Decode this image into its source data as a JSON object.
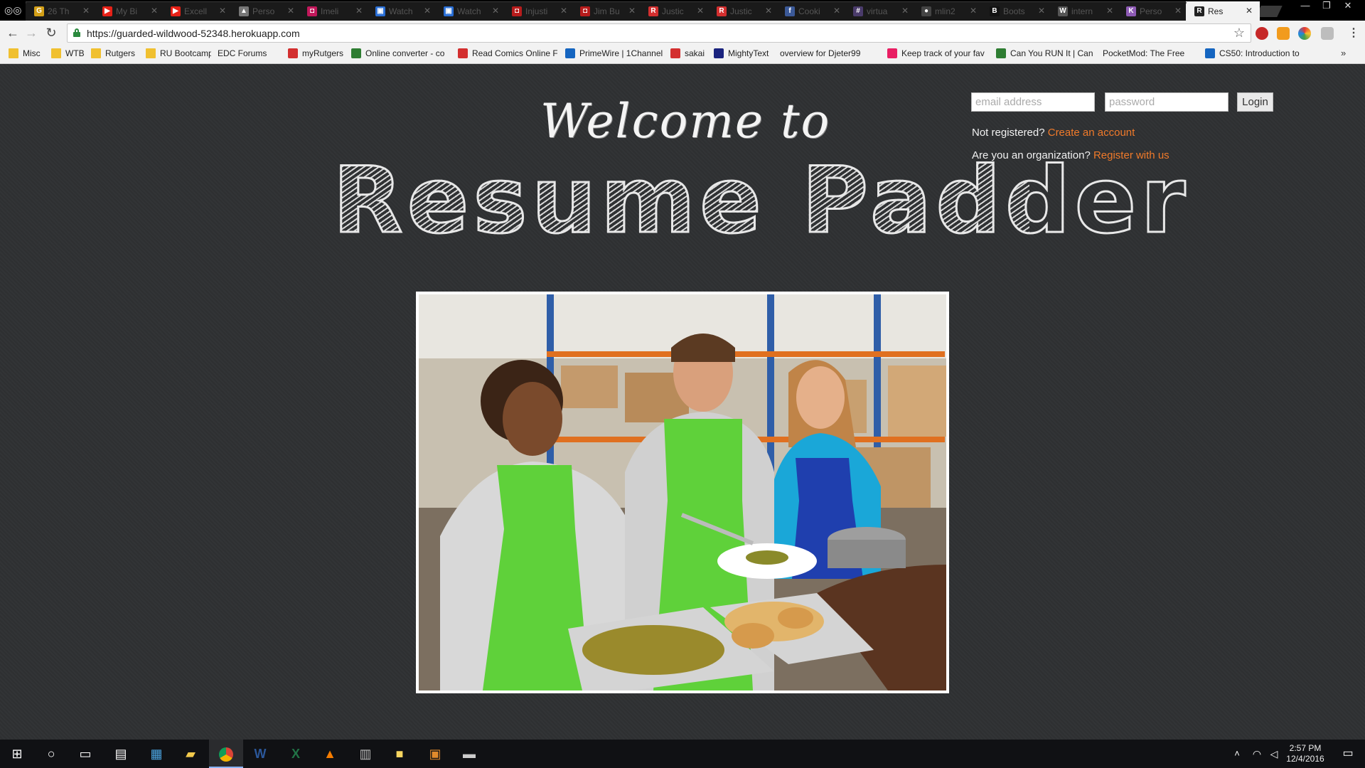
{
  "browser": {
    "tabs": [
      {
        "title": "26 Th",
        "favicon_color": "#d4a017",
        "favicon_glyph": "G"
      },
      {
        "title": "My Bi",
        "favicon_color": "#e62117",
        "favicon_glyph": "▶"
      },
      {
        "title": "Excell",
        "favicon_color": "#e62117",
        "favicon_glyph": "▶"
      },
      {
        "title": "Perso",
        "favicon_color": "#777777",
        "favicon_glyph": "▲"
      },
      {
        "title": "Imeli",
        "favicon_color": "#c2185b",
        "favicon_glyph": "◘"
      },
      {
        "title": "Watch",
        "favicon_color": "#2a6fd6",
        "favicon_glyph": "▣"
      },
      {
        "title": "Watch",
        "favicon_color": "#2a6fd6",
        "favicon_glyph": "▣"
      },
      {
        "title": "Injusti",
        "favicon_color": "#b71c1c",
        "favicon_glyph": "◘"
      },
      {
        "title": "Jim Bu",
        "favicon_color": "#b71c1c",
        "favicon_glyph": "◘"
      },
      {
        "title": "Justic",
        "favicon_color": "#d32f2f",
        "favicon_glyph": "R"
      },
      {
        "title": "Justic",
        "favicon_color": "#d32f2f",
        "favicon_glyph": "R"
      },
      {
        "title": "Cooki",
        "favicon_color": "#3b5998",
        "favicon_glyph": "f"
      },
      {
        "title": "virtua",
        "favicon_color": "#4a3b6b",
        "favicon_glyph": "#"
      },
      {
        "title": "mlin2",
        "favicon_color": "#444444",
        "favicon_glyph": "●"
      },
      {
        "title": "Boots",
        "favicon_color": "#111111",
        "favicon_glyph": "B"
      },
      {
        "title": "intern",
        "favicon_color": "#555555",
        "favicon_glyph": "W"
      },
      {
        "title": "Perso",
        "favicon_color": "#8e5bb5",
        "favicon_glyph": "K"
      },
      {
        "title": "Res",
        "favicon_color": "#222222",
        "favicon_glyph": "R",
        "active": true
      }
    ],
    "url": "https://guarded-wildwood-52348.herokuapp.com",
    "bookmarks": [
      {
        "label": "Misc",
        "icon": "folder"
      },
      {
        "label": "WTB",
        "icon": "folder"
      },
      {
        "label": "Rutgers",
        "icon": "folder"
      },
      {
        "label": "RU Bootcamp",
        "icon": "folder"
      },
      {
        "label": "EDC Forums",
        "icon": "page"
      },
      {
        "label": "myRutgers",
        "icon": "red"
      },
      {
        "label": "Online converter - co",
        "icon": "green"
      },
      {
        "label": "Read Comics Online F",
        "icon": "red"
      },
      {
        "label": "PrimeWire | 1Channel",
        "icon": "blue"
      },
      {
        "label": "sakai",
        "icon": "red"
      },
      {
        "label": "MightyText",
        "icon": "navy"
      },
      {
        "label": "overview for Djeter99",
        "icon": "page"
      },
      {
        "label": "Keep track of your fav",
        "icon": "pink"
      },
      {
        "label": "Can You RUN It | Can",
        "icon": "green"
      },
      {
        "label": "PocketMod: The Free",
        "icon": "page"
      },
      {
        "label": "CS50: Introduction to",
        "icon": "blue"
      }
    ]
  },
  "page": {
    "welcome": "Welcome to",
    "brand": "Resume Padder",
    "login": {
      "email_placeholder": "email address",
      "password_placeholder": "password",
      "button": "Login"
    },
    "not_registered": "Not registered?",
    "create_account": "Create an account",
    "org_question": "Are you an organization?",
    "register_org": "Register with us",
    "hero_alt": "Volunteers serving food"
  },
  "taskbar": {
    "time": "2:57 PM",
    "date": "12/4/2016"
  },
  "colors": {
    "link": "#f07a2a",
    "page_bg": "#2f3133",
    "apron": "#5fd13a"
  }
}
